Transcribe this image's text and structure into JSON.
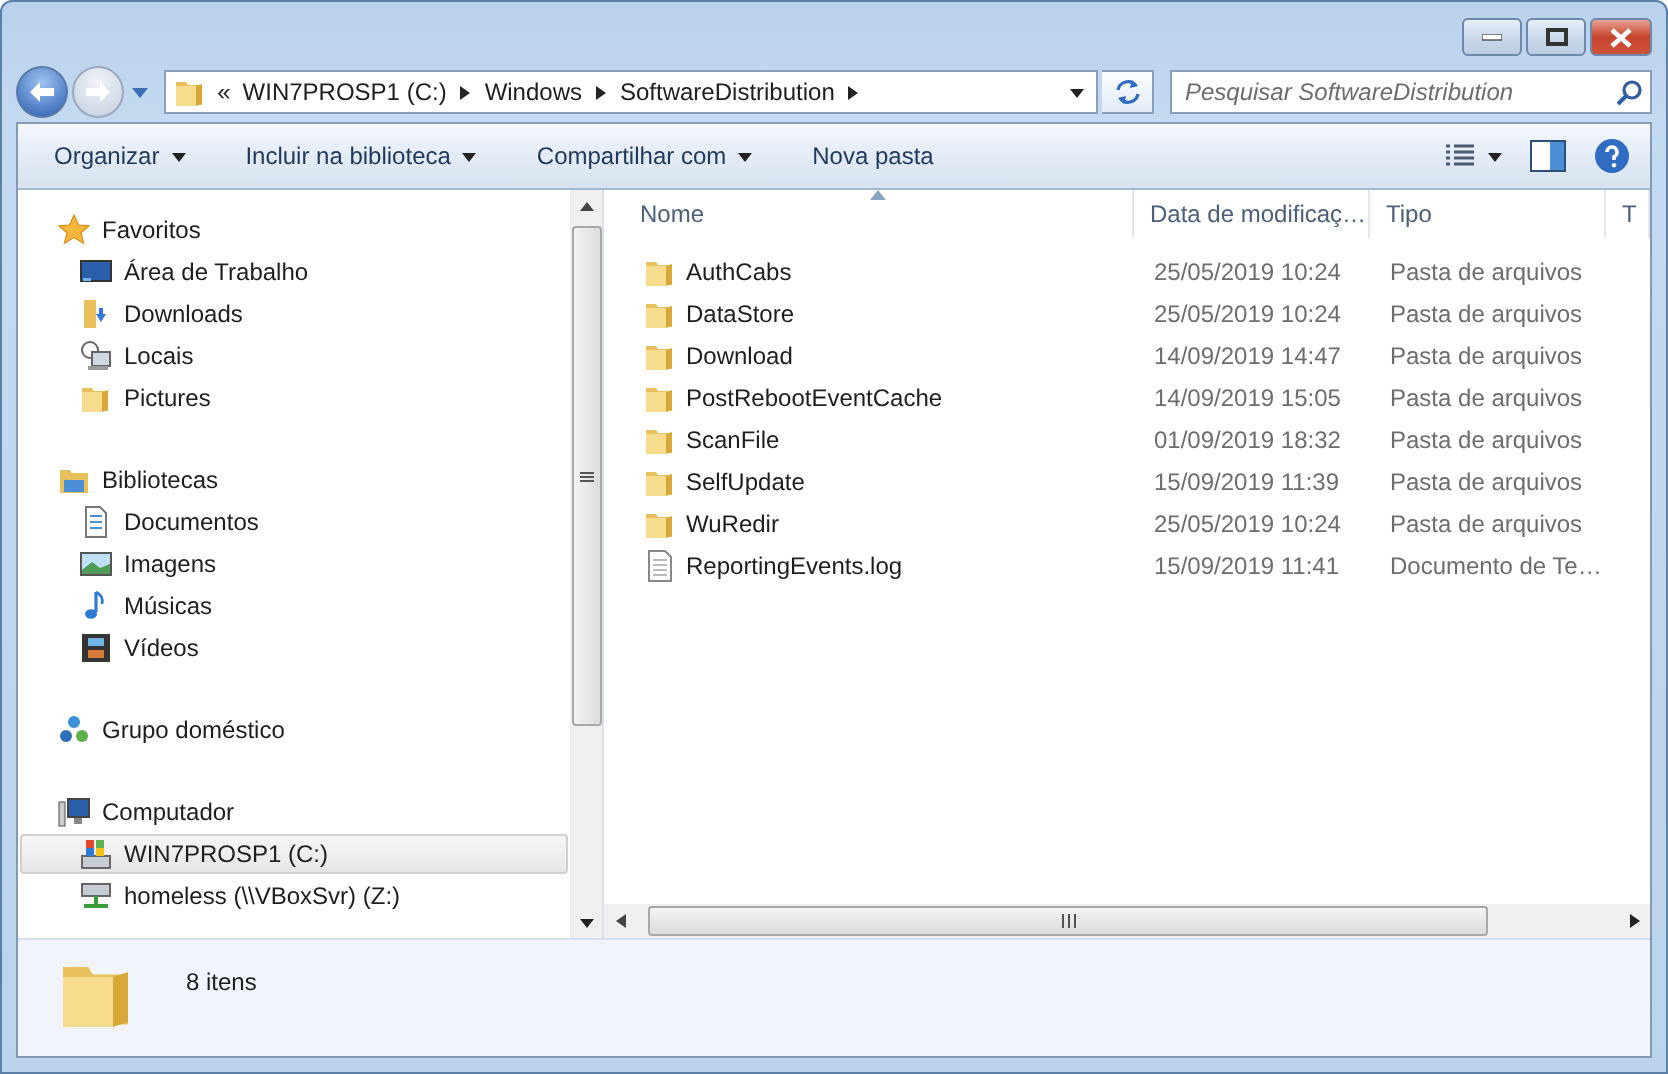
{
  "address": {
    "overflow": "«",
    "crumbs": [
      {
        "label": "WIN7PROSP1 (C:)"
      },
      {
        "label": "Windows"
      },
      {
        "label": "SoftwareDistribution"
      }
    ]
  },
  "search": {
    "placeholder": "Pesquisar SoftwareDistribution"
  },
  "toolbar": [
    {
      "label": "Organizar",
      "has_menu": true
    },
    {
      "label": "Incluir na biblioteca",
      "has_menu": true
    },
    {
      "label": "Compartilhar com",
      "has_menu": true
    },
    {
      "label": "Nova pasta",
      "has_menu": false
    }
  ],
  "nav": [
    {
      "label": "Favoritos",
      "kind": "star",
      "selected": false,
      "children": [
        {
          "label": "Área de Trabalho",
          "kind": "desktop",
          "selected": false
        },
        {
          "label": "Downloads",
          "kind": "downloads",
          "selected": false
        },
        {
          "label": "Locais",
          "kind": "places",
          "selected": false
        },
        {
          "label": "Pictures",
          "kind": "folder",
          "selected": false
        }
      ]
    },
    {
      "label": "Bibliotecas",
      "kind": "library",
      "selected": false,
      "children": [
        {
          "label": "Documentos",
          "kind": "document",
          "selected": false
        },
        {
          "label": "Imagens",
          "kind": "image",
          "selected": false
        },
        {
          "label": "Músicas",
          "kind": "music",
          "selected": false
        },
        {
          "label": "Vídeos",
          "kind": "video",
          "selected": false
        }
      ]
    },
    {
      "label": "Grupo doméstico",
      "kind": "homegroup",
      "selected": false
    },
    {
      "label": "Computador",
      "kind": "computer",
      "selected": false,
      "children": [
        {
          "label": "WIN7PROSP1 (C:)",
          "kind": "drive",
          "selected": true
        },
        {
          "label": "homeless (\\\\VBoxSvr) (Z:)",
          "kind": "network",
          "selected": false
        }
      ]
    }
  ],
  "columns": [
    {
      "label": "Nome",
      "sorted": true
    },
    {
      "label": "Data de modificaç…",
      "sorted": false
    },
    {
      "label": "Tipo",
      "sorted": false
    },
    {
      "label": "T",
      "sorted": false
    }
  ],
  "rows": [
    {
      "name": "AuthCabs",
      "date": "25/05/2019 10:24",
      "type": "Pasta de arquivos",
      "kind": "folder"
    },
    {
      "name": "DataStore",
      "date": "25/05/2019 10:24",
      "type": "Pasta de arquivos",
      "kind": "folder"
    },
    {
      "name": "Download",
      "date": "14/09/2019 14:47",
      "type": "Pasta de arquivos",
      "kind": "folder"
    },
    {
      "name": "PostRebootEventCache",
      "date": "14/09/2019 15:05",
      "type": "Pasta de arquivos",
      "kind": "folder"
    },
    {
      "name": "ScanFile",
      "date": "01/09/2019 18:32",
      "type": "Pasta de arquivos",
      "kind": "folder"
    },
    {
      "name": "SelfUpdate",
      "date": "15/09/2019 11:39",
      "type": "Pasta de arquivos",
      "kind": "folder"
    },
    {
      "name": "WuRedir",
      "date": "25/05/2019 10:24",
      "type": "Pasta de arquivos",
      "kind": "folder"
    },
    {
      "name": "ReportingEvents.log",
      "date": "15/09/2019 11:41",
      "type": "Documento de Te…",
      "kind": "file"
    }
  ],
  "status": {
    "count": "8 itens"
  }
}
